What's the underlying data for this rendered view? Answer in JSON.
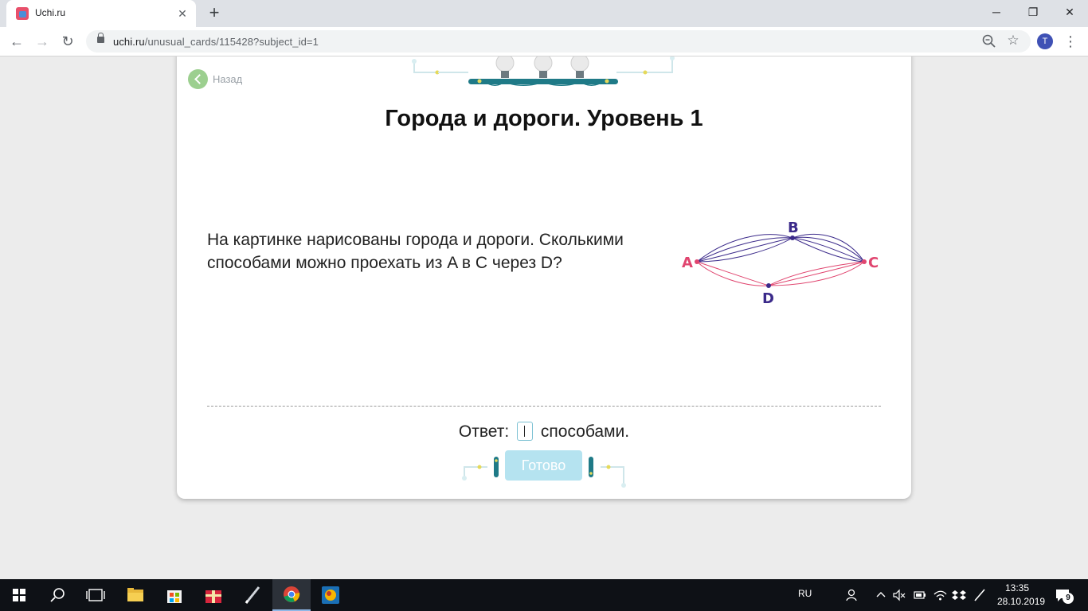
{
  "browser": {
    "tab_title": "Uchi.ru",
    "close_glyph": "✕",
    "new_tab_glyph": "+",
    "url_host": "uchi.ru",
    "url_path": "/unusual_cards/115428?subject_id=1",
    "profile_initial": "T",
    "window_controls": {
      "minimize": "─",
      "restore": "❐",
      "close": "✕"
    },
    "nav": {
      "back": "←",
      "forward": "→",
      "reload": "↻"
    },
    "star_glyph": "☆",
    "menu_glyph": "⋮"
  },
  "page": {
    "back_label": "Назад",
    "title": "Города и дороги. Уровень 1",
    "question": "На картинке нарисованы города и дороги. Сколькими способами можно проехать из A в C через D?",
    "answer_prefix": "Ответ:",
    "answer_value": "",
    "answer_suffix": "способами.",
    "ready_label": "Готово"
  },
  "graph": {
    "nodes": {
      "A": "A",
      "B": "B",
      "C": "C",
      "D": "D"
    },
    "colors": {
      "blue_roads": "#3b2a8a",
      "red_roads": "#e0456f",
      "label_blue": "#3b2a8a",
      "label_red": "#e0456f"
    },
    "roads": {
      "A_B": 4,
      "B_C": 4,
      "A_D": 2,
      "D_C": 3
    }
  },
  "taskbar": {
    "language": "RU",
    "time": "13:35",
    "date": "28.10.2019",
    "notification_count": "9",
    "icons": [
      "windows-start-icon",
      "search-icon",
      "task-view-icon",
      "file-explorer-icon",
      "store-icon",
      "gift-icon",
      "pen-icon",
      "chrome-icon",
      "game-icon"
    ]
  },
  "colors": {
    "accent": "#7cc1d3",
    "button_disabled": "#b5e3f0",
    "back_green": "#9ccf8f"
  }
}
